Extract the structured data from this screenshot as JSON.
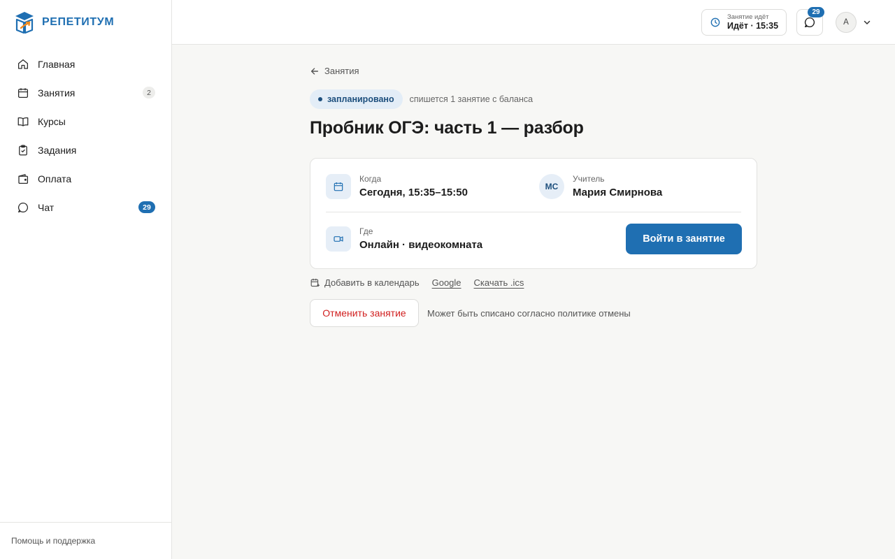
{
  "app": {
    "brand_name": "РЕПЕТИТУМ",
    "accent_color": "#1f6fb2",
    "danger_color": "#d11f1f"
  },
  "sidebar": {
    "items": [
      {
        "label": "Главная",
        "icon": "home-icon",
        "count": ""
      },
      {
        "label": "Занятия",
        "icon": "calendar-icon",
        "count": "2"
      },
      {
        "label": "Курсы",
        "icon": "book-icon",
        "count": ""
      },
      {
        "label": "Задания",
        "icon": "clipboard-check-icon",
        "count": ""
      },
      {
        "label": "Оплата",
        "icon": "wallet-icon",
        "count": ""
      },
      {
        "label": "Чат",
        "icon": "chat-icon",
        "count": "29"
      }
    ],
    "footer_link": "Помощь и поддержка"
  },
  "header": {
    "live_caption": "Занятие идёт",
    "live_value": "Идёт · 15:35",
    "chat_count": "29",
    "avatar_initial": "A"
  },
  "lesson": {
    "back_label": "Занятия",
    "status_label": "запланировано",
    "status_note": "спишется 1 занятие с баланса",
    "title": "Пробник ОГЭ: часть 1 — разбор",
    "when_caption": "Когда",
    "when_value": "Сегодня, 15:35–15:50",
    "teacher_caption": "Учитель",
    "teacher_initials": "МС",
    "teacher_name": "Мария Смирнова",
    "where_caption": "Где",
    "where_value": "Онлайн · видеокомната",
    "join_label": "Войти в занятие",
    "calendar_label": "Добавить в календарь",
    "calendar_google": "Google",
    "calendar_ics": "Скачать .ics",
    "cancel_label": "Отменить занятие",
    "cancel_note": "Может быть списано согласно политике отмены"
  }
}
